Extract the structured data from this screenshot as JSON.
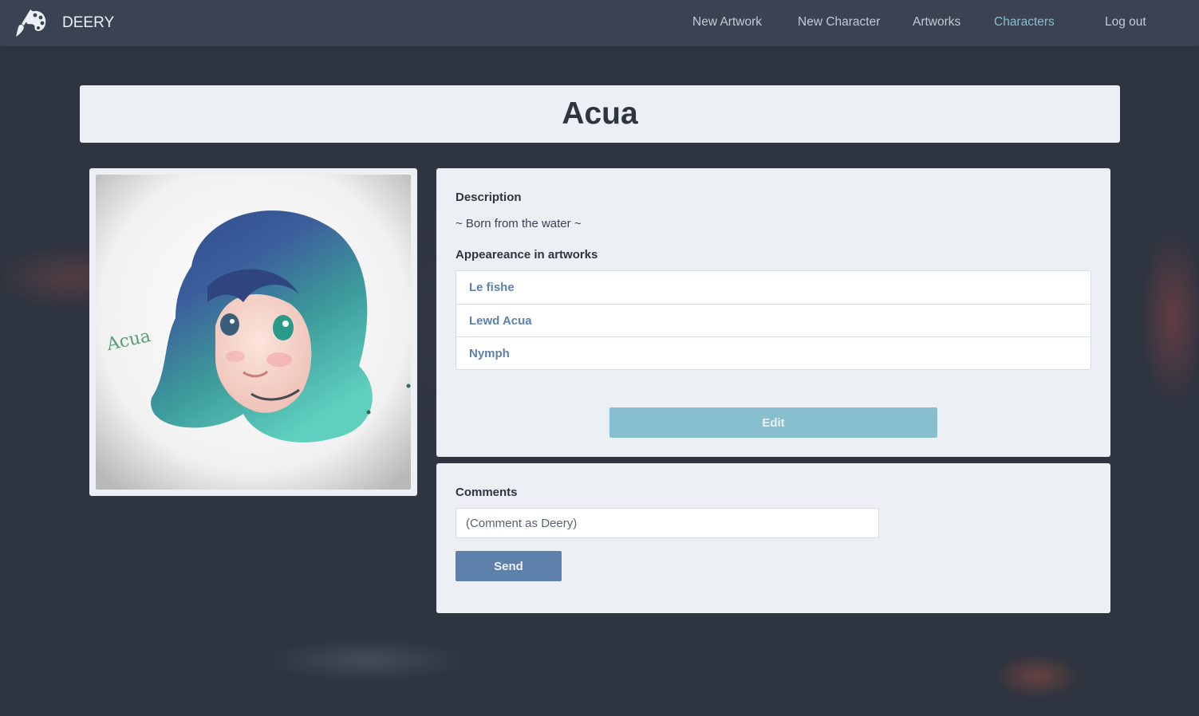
{
  "brand": {
    "name": "DEERY",
    "logo_icon": "paintbrush-palette-icon"
  },
  "nav": {
    "items": [
      {
        "label": "New Artwork",
        "active": false
      },
      {
        "label": "New Character",
        "active": false
      },
      {
        "label": "Artworks",
        "active": false
      },
      {
        "label": "Characters",
        "active": true
      },
      {
        "label": "Log out",
        "active": false
      }
    ]
  },
  "character": {
    "name": "Acua",
    "description_label": "Description",
    "description": "~ Born from the water ~",
    "artworks_label": "Appeareance in artworks",
    "artworks": [
      "Le fishe",
      "Lewd Acua",
      "Nymph"
    ],
    "edit_label": "Edit"
  },
  "comments": {
    "label": "Comments",
    "input_value": "",
    "input_placeholder": "(Comment as Deery)",
    "send_label": "Send"
  },
  "colors": {
    "nav_bg": "#3b4252",
    "page_bg": "#2e3440",
    "card_bg": "#eceff4",
    "active_link": "#88c0d0",
    "link": "#5e81ac",
    "edit_button": "#88bfcf",
    "send_button": "#5e81ac"
  }
}
